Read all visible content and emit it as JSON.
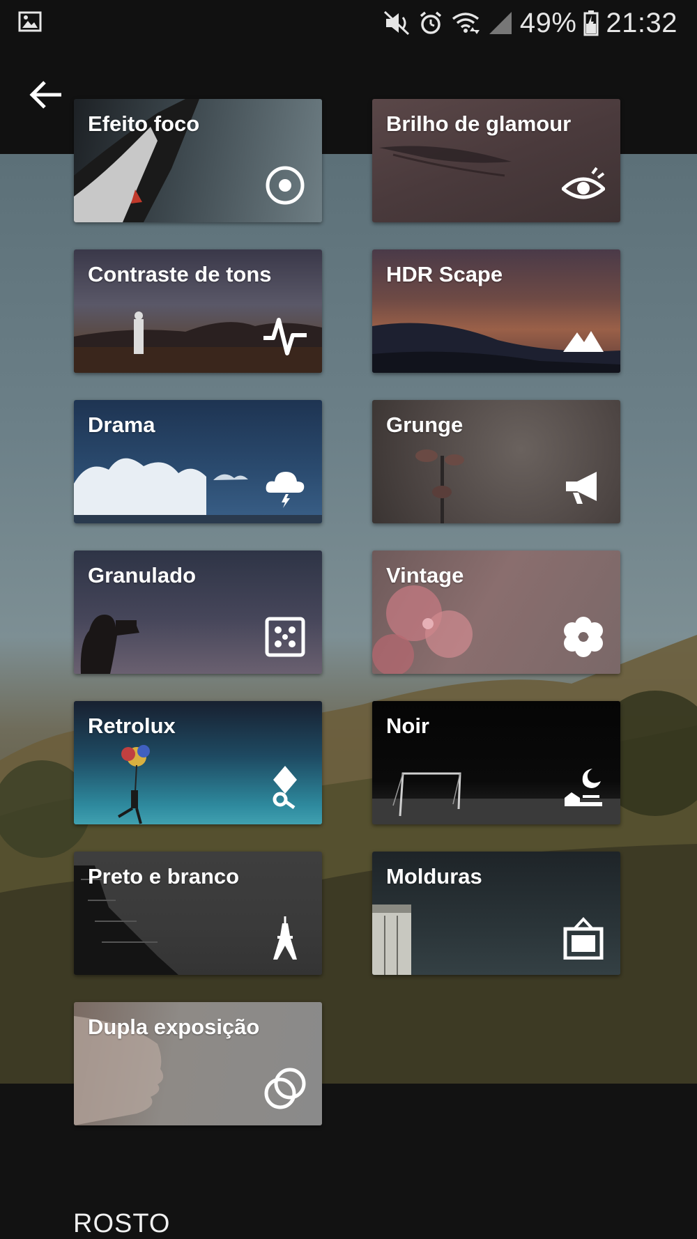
{
  "status_bar": {
    "battery": "49%",
    "time": "21:32",
    "icons": [
      "image-icon",
      "mute-icon",
      "alarm-icon",
      "wifi-icon",
      "signal-icon",
      "battery-icon"
    ]
  },
  "header": {
    "back_icon": "arrow-left-icon"
  },
  "filters": [
    {
      "label": "Efeito foco",
      "icon": "focus-target-icon"
    },
    {
      "label": "Brilho de glamour",
      "icon": "eye-icon"
    },
    {
      "label": "Contraste de tons",
      "icon": "pulse-icon"
    },
    {
      "label": "HDR Scape",
      "icon": "mountain-icon"
    },
    {
      "label": "Drama",
      "icon": "storm-cloud-icon"
    },
    {
      "label": "Grunge",
      "icon": "megaphone-icon"
    },
    {
      "label": "Granulado",
      "icon": "dice-icon"
    },
    {
      "label": "Vintage",
      "icon": "flower-icon"
    },
    {
      "label": "Retrolux",
      "icon": "diamond-key-icon"
    },
    {
      "label": "Noir",
      "icon": "moon-scene-icon"
    },
    {
      "label": "Preto e branco",
      "icon": "eiffel-tower-icon"
    },
    {
      "label": "Molduras",
      "icon": "frame-icon"
    },
    {
      "label": "Dupla exposição",
      "icon": "double-circle-icon"
    }
  ],
  "section": {
    "title": "ROSTO"
  },
  "colors": {
    "background": "#121212",
    "text": "#ffffff"
  }
}
